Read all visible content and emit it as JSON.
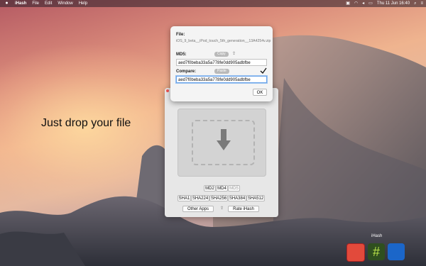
{
  "menubar": {
    "app_name": "iHash",
    "menus": [
      "File",
      "Edit",
      "Window",
      "Help"
    ],
    "clock": "Thu 11 Jun 16:40"
  },
  "desktop": {
    "tagline": "Just drop your file"
  },
  "popover": {
    "file_label": "File:",
    "file_name": "iOS_9_beta__iPod_touch_5th_generation__13A4254v.zip",
    "md5_label": "MD5:",
    "copy_label": "Copy",
    "md5_value": "aed7f0beba33a5a778fe0dd905adbfbe",
    "compare_label": "Compare:",
    "paste_label": "Paste",
    "compare_value": "aed7f0beba33a5a778fe0dd905adbfbe",
    "ok_label": "OK"
  },
  "app_window": {
    "hash_row1": [
      "MD2",
      "MD4",
      "MD5"
    ],
    "hash_row2": [
      "SHA1",
      "SHA224",
      "SHA256",
      "SHA384",
      "SHA512"
    ],
    "other_apps_label": "Other Apps",
    "rate_label": "Rate iHash"
  },
  "dock": {
    "label": "iHash"
  }
}
